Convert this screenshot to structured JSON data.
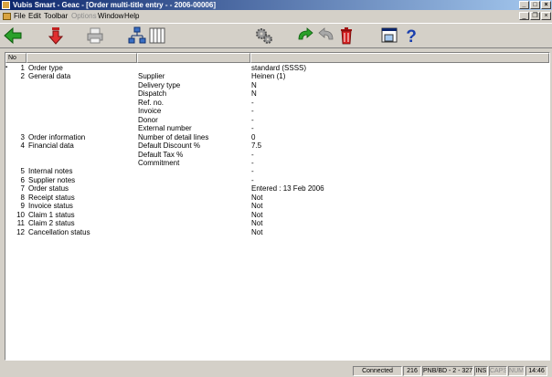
{
  "window": {
    "title": "Vubis Smart - Geac - [Order multi-title entry - - 2006-00006]",
    "controls": {
      "minimize": "_",
      "maximize": "□",
      "close": "×"
    }
  },
  "menu": {
    "items": [
      {
        "label": "File",
        "enabled": true
      },
      {
        "label": "Edit",
        "enabled": true
      },
      {
        "label": "Toolbar",
        "enabled": true
      },
      {
        "label": "Options",
        "enabled": false
      },
      {
        "label": "Window",
        "enabled": true
      },
      {
        "label": "Help",
        "enabled": true
      }
    ],
    "mdi_controls": {
      "minimize": "_",
      "restore": "❐",
      "close": "×"
    }
  },
  "toolbar": {
    "buttons": [
      {
        "name": "back-button",
        "icon": "green-left-arrow-icon"
      },
      {
        "name": "down-button",
        "icon": "red-down-arrow-icon"
      },
      {
        "name": "print-button",
        "icon": "printer-icon"
      },
      {
        "name": "tree-button",
        "icon": "network-tree-icon"
      },
      {
        "name": "columns-button",
        "icon": "columns-icon"
      },
      {
        "name": "settings-button",
        "icon": "gears-icon"
      },
      {
        "name": "redo-button",
        "icon": "redo-arrow-icon"
      },
      {
        "name": "undo-button",
        "icon": "undo-arrow-icon"
      },
      {
        "name": "delete-button",
        "icon": "trash-icon"
      },
      {
        "name": "window-button",
        "icon": "window-icon"
      },
      {
        "name": "help-button",
        "icon": "question-mark-icon"
      }
    ]
  },
  "grid": {
    "header": {
      "no": "No",
      "col2": "",
      "col3": "",
      "col4": ""
    },
    "rows": [
      {
        "no": "1",
        "label": "Order type",
        "sub": "",
        "value": "standard (SSSS)"
      },
      {
        "no": "2",
        "label": "General data",
        "sub": "Supplier",
        "value": "Heinen (1)"
      },
      {
        "no": "",
        "label": "",
        "sub": "Delivery type",
        "value": "N"
      },
      {
        "no": "",
        "label": "",
        "sub": "Dispatch",
        "value": "N"
      },
      {
        "no": "",
        "label": "",
        "sub": "Ref. no.",
        "value": "-"
      },
      {
        "no": "",
        "label": "",
        "sub": "Invoice",
        "value": "-"
      },
      {
        "no": "",
        "label": "",
        "sub": "Donor",
        "value": "-"
      },
      {
        "no": "",
        "label": "",
        "sub": "External number",
        "value": "-"
      },
      {
        "no": "3",
        "label": "Order information",
        "sub": "Number of detail lines",
        "value": "0"
      },
      {
        "no": "4",
        "label": "Financial data",
        "sub": "Default Discount %",
        "value": "7.5"
      },
      {
        "no": "",
        "label": "",
        "sub": "Default Tax %",
        "value": "-"
      },
      {
        "no": "",
        "label": "",
        "sub": "Commitment",
        "value": "-"
      },
      {
        "no": "5",
        "label": "Internal notes",
        "sub": "",
        "value": "-"
      },
      {
        "no": "6",
        "label": "Supplier notes",
        "sub": "",
        "value": "-"
      },
      {
        "no": "7",
        "label": "Order status",
        "sub": "",
        "value": "Entered  :  13 Feb 2006"
      },
      {
        "no": "8",
        "label": "Receipt status",
        "sub": "",
        "value": "Not"
      },
      {
        "no": "9",
        "label": "Invoice status",
        "sub": "",
        "value": "Not"
      },
      {
        "no": "10",
        "label": "Claim 1 status",
        "sub": "",
        "value": "Not"
      },
      {
        "no": "11",
        "label": "Claim 2 status",
        "sub": "",
        "value": "Not"
      },
      {
        "no": "12",
        "label": "Cancellation status",
        "sub": "",
        "value": "Not"
      }
    ],
    "current_row_marker": "▪"
  },
  "statusbar": {
    "connection": "Connected",
    "code": "216",
    "database": "PNB/BD - 2 - 3272",
    "ins": "INS",
    "caps": "CAPS",
    "num": "NUM",
    "time": "14:46"
  },
  "colors": {
    "titlebar_start": "#0a246a",
    "titlebar_end": "#a6caf0",
    "chrome": "#d4d0c8"
  }
}
